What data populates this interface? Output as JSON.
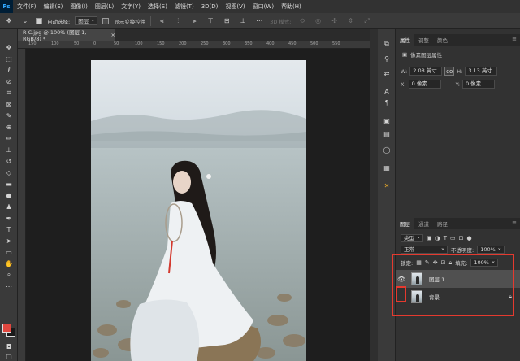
{
  "app": {
    "logo": "Ps"
  },
  "menu": {
    "items": [
      "文件(F)",
      "编辑(E)",
      "图像(I)",
      "图层(L)",
      "文字(Y)",
      "选择(S)",
      "滤镜(T)",
      "3D(D)",
      "视图(V)",
      "窗口(W)",
      "帮助(H)"
    ]
  },
  "options": {
    "auto_select_label": "自动选择:",
    "auto_select_value": "图层",
    "transform_label": "显示变换控件",
    "mode_3d_label": "3D 模式:"
  },
  "document": {
    "tab_title": "R-C.jpg @ 100% (图层 1, RGB/8) *",
    "close": "×",
    "ruler_ticks": [
      "150",
      "100",
      "50",
      "0",
      "50",
      "100",
      "150",
      "200",
      "250",
      "300",
      "350",
      "400",
      "450",
      "500",
      "550"
    ]
  },
  "properties": {
    "tabs": [
      "属性",
      "调整",
      "颜色"
    ],
    "title": "像素图层属性",
    "w_label": "W:",
    "w_value": "2.08 英寸",
    "h_label": "H:",
    "h_value": "3.13 英寸",
    "x_label": "X:",
    "x_value": "0 像素",
    "y_label": "Y:",
    "y_value": "0 像素",
    "link_icon": "co"
  },
  "layers": {
    "tabs": [
      "图层",
      "通道",
      "路径"
    ],
    "filter_label": "类型",
    "blend_mode": "正常",
    "opacity_label": "不透明度:",
    "opacity_value": "100%",
    "lock_label": "锁定:",
    "fill_label": "填充:",
    "fill_value": "100%",
    "items": [
      {
        "name": "图层 1",
        "visible": true,
        "selected": true,
        "locked": false
      },
      {
        "name": "背景",
        "visible": false,
        "selected": false,
        "locked": true
      }
    ]
  },
  "colors": {
    "foreground": "#e0473f",
    "background": "#1a1a1a",
    "highlight": "#e53a2f"
  }
}
